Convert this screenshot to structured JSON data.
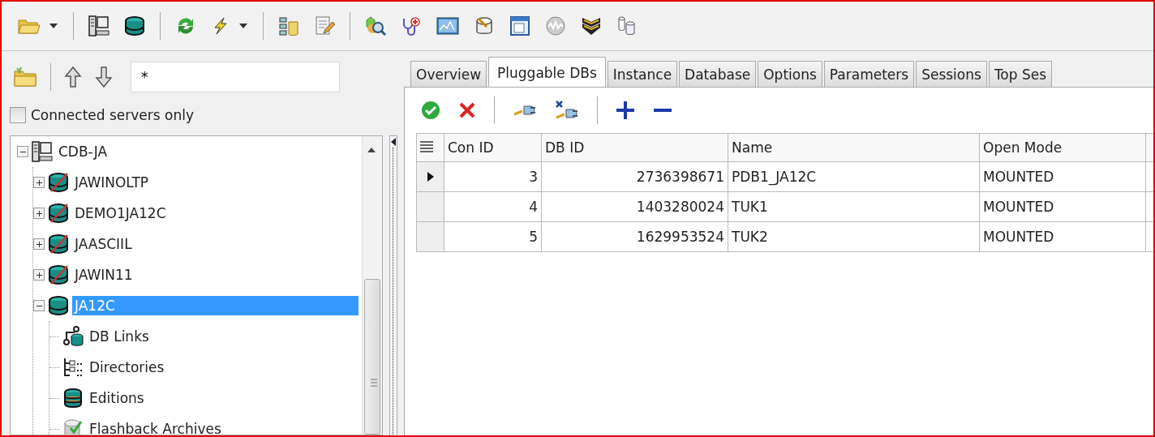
{
  "filter": {
    "value": "*"
  },
  "connected_only": {
    "label": "Connected servers only",
    "checked": false
  },
  "tree": [
    {
      "label": "CDB-JA",
      "kind": "server",
      "expanded": true,
      "selected": false,
      "children": [
        {
          "label": "JAWINOLTP",
          "kind": "db-off",
          "expanded": false,
          "selected": false
        },
        {
          "label": "DEMO1JA12C",
          "kind": "db-off",
          "expanded": false,
          "selected": false
        },
        {
          "label": "JAASCIIL",
          "kind": "db-off",
          "expanded": false,
          "selected": false
        },
        {
          "label": "JAWIN11",
          "kind": "db-off",
          "expanded": false,
          "selected": false
        },
        {
          "label": "JA12C",
          "kind": "db",
          "expanded": true,
          "selected": true,
          "children": [
            {
              "label": "DB Links",
              "kind": "links",
              "selected": false
            },
            {
              "label": "Directories",
              "kind": "dirs",
              "selected": false
            },
            {
              "label": "Editions",
              "kind": "editions",
              "selected": false
            },
            {
              "label": "Flashback Archives",
              "kind": "flashback",
              "selected": false
            }
          ]
        }
      ]
    }
  ],
  "tabs": [
    {
      "label": "Overview",
      "selected": false
    },
    {
      "label": "Pluggable DBs",
      "selected": true
    },
    {
      "label": "Instance",
      "selected": false
    },
    {
      "label": "Database",
      "selected": false
    },
    {
      "label": "Options",
      "selected": false
    },
    {
      "label": "Parameters",
      "selected": false
    },
    {
      "label": "Sessions",
      "selected": false
    },
    {
      "label": "Top Ses",
      "selected": false
    }
  ],
  "table": {
    "columns": [
      "Con ID",
      "DB ID",
      "Name",
      "Open Mode"
    ],
    "rows": [
      {
        "cells": [
          "3",
          "2736398671",
          "PDB1_JA12C",
          "MOUNTED"
        ],
        "selected": true
      },
      {
        "cells": [
          "4",
          "1403280024",
          "TUK1",
          "MOUNTED"
        ],
        "selected": false
      },
      {
        "cells": [
          "5",
          "1629953524",
          "TUK2",
          "MOUNTED"
        ],
        "selected": false
      }
    ]
  }
}
